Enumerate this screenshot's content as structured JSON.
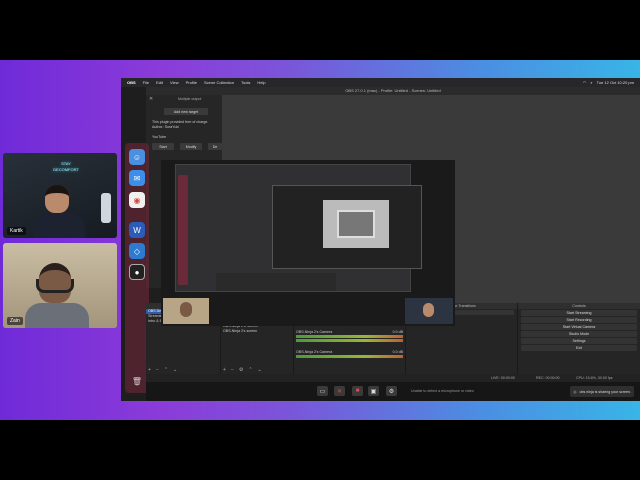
{
  "participants": [
    {
      "name": "Kartik",
      "neon_line1": "STAY",
      "neon_line2": "DECOMFORT"
    },
    {
      "name": "Zain"
    }
  ],
  "menubar": {
    "app": "OBS",
    "items": [
      "File",
      "Edit",
      "View",
      "Profile",
      "Scene Collection",
      "Tools",
      "Help"
    ],
    "clock": "Tue 12 Oct  10:20 pm"
  },
  "window_title": "OBS 27.0.1 (mac) - Profile: Untitled - Scenes: Untitled",
  "plugin": {
    "title": "Multiple output",
    "add_button": "Add new target",
    "description": "This plugin provided free of charge.",
    "author": "Author: SoraYuki",
    "target_name": "YouTube",
    "start": "Start",
    "modify": "Modify",
    "delete": "De"
  },
  "scenes": {
    "header": "Scenes",
    "items": [
      "OBS Default",
      "Streaming Gizmo",
      "Intro & Ending"
    ]
  },
  "sources": {
    "label": "OBS-Ninja 2's Camera",
    "header": "Sources",
    "items": [
      "AI",
      "OBS-Ninja K's Camera",
      "OBS-Ninja 2's Camera",
      "OBS-Ninja K's Screen",
      "OBS-Ninja 2's screen"
    ],
    "tabs": [
      "Properties",
      "Filters",
      "Interact",
      "Refresh"
    ]
  },
  "mixer": {
    "header": "Audio Mixer",
    "channels": [
      {
        "name": "Mic/Aux",
        "db": "0.0 dB"
      },
      {
        "name": "OBS-Ninja 2's Camera",
        "db": "0.0 dB"
      },
      {
        "name": "OBS-Ninja 2's Camera",
        "db": "0.0 dB"
      }
    ]
  },
  "transitions": {
    "header": "Scene Transitions",
    "type": "Fade",
    "duration_label": "Duration",
    "duration": "300 ms"
  },
  "controls": {
    "header": "Controls",
    "buttons": [
      "Start Streaming",
      "Start Recording",
      "Start Virtual Camera",
      "Studio Mode",
      "Settings",
      "Exit"
    ]
  },
  "status": {
    "live": "LIVE: 00:00:00",
    "rec": "REC: 00:00:00",
    "cpu": "CPU: 15.6%, 30.00 fps"
  },
  "meeting_bar": {
    "notice": "Unable to detect a microphone or video",
    "share_text": "obs ninja is sharing your screen."
  },
  "colors": {
    "accent": "#2a5bb0",
    "obs_bg": "#1e1e1e",
    "gradient_left": "#6f2ad8",
    "gradient_right": "#38b5e6"
  }
}
